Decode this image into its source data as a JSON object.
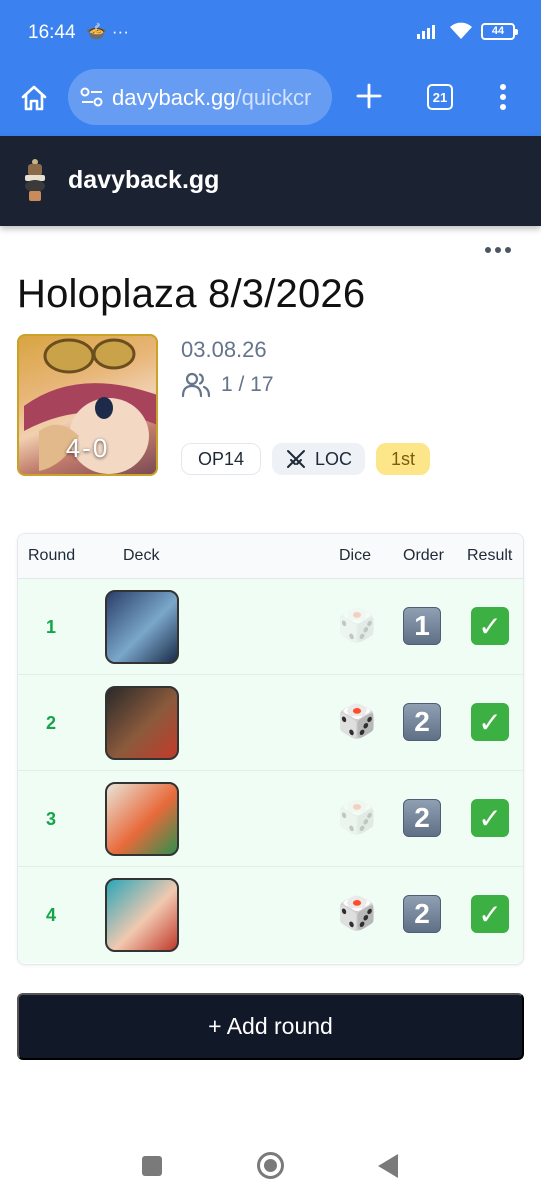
{
  "status_bar": {
    "time": "16:44",
    "left_icons": "🍲 ···",
    "battery": "44"
  },
  "browser": {
    "url_host": "davyback.gg",
    "url_path": "/quickcr",
    "tab_count": "21"
  },
  "site": {
    "brand": "davyback.gg"
  },
  "event": {
    "title": "Holoplaza 8/3/2026",
    "score": "4-0",
    "date": "03.08.26",
    "players": "1 / 17",
    "badges": {
      "set": "OP14",
      "loc": "LOC",
      "place": "1st"
    }
  },
  "table": {
    "headers": {
      "round": "Round",
      "deck": "Deck",
      "dice": "Dice",
      "order": "Order",
      "result": "Result"
    },
    "rows": [
      {
        "round": "1",
        "dice": "🎲",
        "dice_won": false,
        "order": "1",
        "result": "✓",
        "deck_colors": [
          "#2b3f6b",
          "#7aa7c9",
          "#1a2a4a"
        ]
      },
      {
        "round": "2",
        "dice": "🎲",
        "dice_won": true,
        "order": "2",
        "result": "✓",
        "deck_colors": [
          "#2a2a2a",
          "#8b5a3c",
          "#c23b2b"
        ]
      },
      {
        "round": "3",
        "dice": "🎲",
        "dice_won": false,
        "order": "2",
        "result": "✓",
        "deck_colors": [
          "#e8e4d8",
          "#e86a3b",
          "#2f8f4e"
        ]
      },
      {
        "round": "4",
        "dice": "🎲",
        "dice_won": true,
        "order": "2",
        "result": "✓",
        "deck_colors": [
          "#2aa6b8",
          "#f1c9b0",
          "#c0392b"
        ]
      }
    ]
  },
  "actions": {
    "add_round": "+ Add round"
  },
  "colors": {
    "browser_blue": "#3b82f0",
    "header_dark": "#1b2232",
    "win_green": "#16a34a",
    "button_dark": "#111827"
  }
}
